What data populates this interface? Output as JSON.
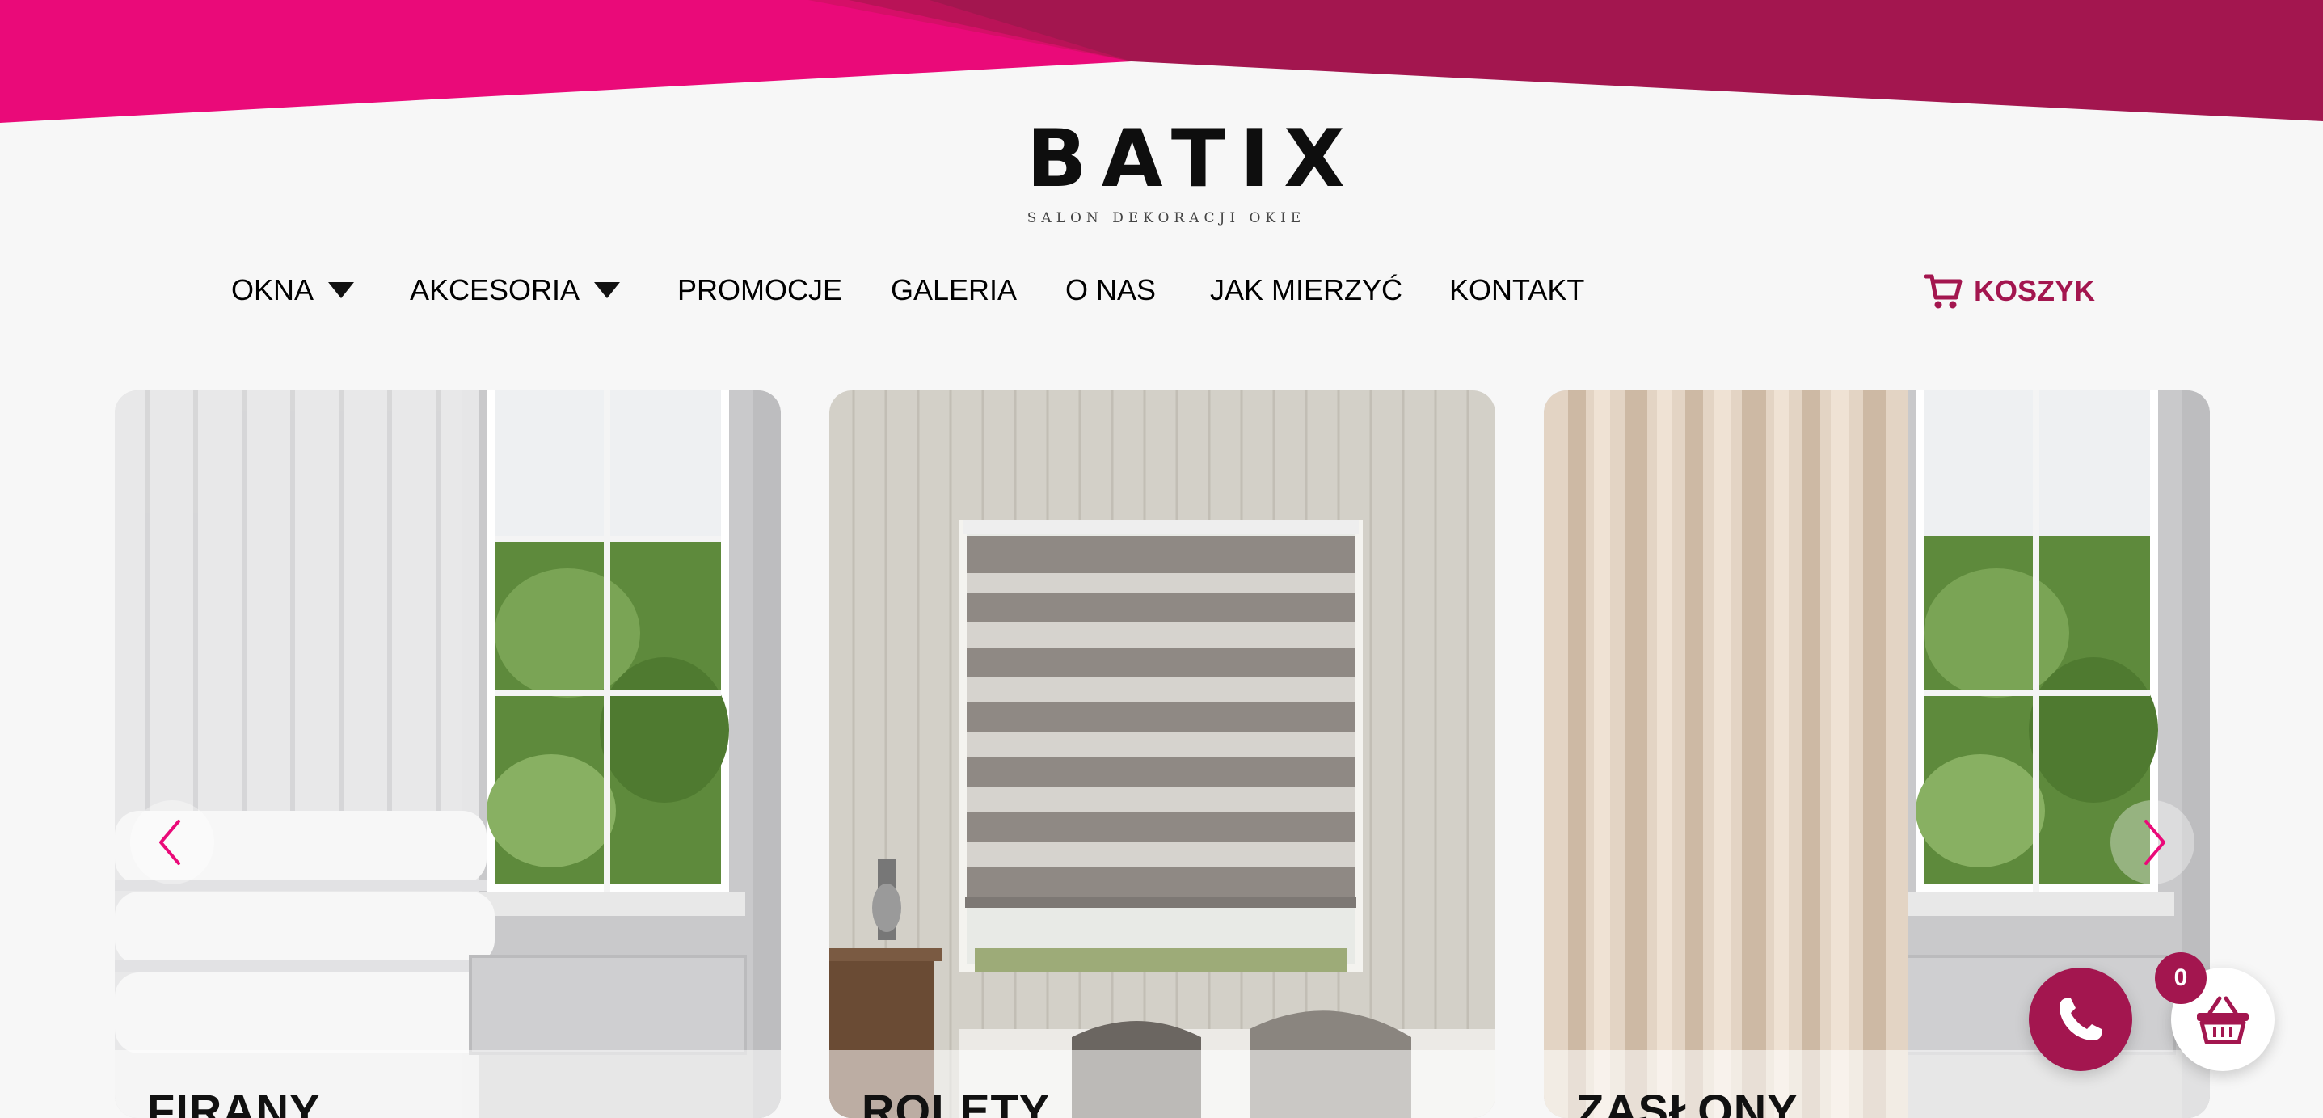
{
  "colors": {
    "brand": "#a3164f",
    "accent_pink": "#ea0a79",
    "background": "#f7f7f7"
  },
  "logo": {
    "wordmark": "BATIX",
    "tagline": "SALON DEKORACJI OKIE"
  },
  "nav": {
    "items": [
      {
        "label": "OKNA",
        "has_dropdown": true
      },
      {
        "label": "AKCESORIA",
        "has_dropdown": true
      },
      {
        "label": "PROMOCJE"
      },
      {
        "label": "GALERIA"
      },
      {
        "label": "O NAS"
      },
      {
        "label": "JAK MIERZYĆ"
      },
      {
        "label": "KONTAKT"
      }
    ],
    "cart_label": "KOSZYK",
    "cart_icon": "cart-icon"
  },
  "carousel": {
    "cards": [
      {
        "title": "FIRANY",
        "image": "sheer-curtain-window-photo"
      },
      {
        "title": "ROLETY",
        "image": "roller-blind-window-photo"
      },
      {
        "title": "ZASŁONY",
        "image": "drape-curtain-window-photo"
      }
    ],
    "prev_icon": "chevron-left-icon",
    "next_icon": "chevron-right-icon"
  },
  "floating": {
    "phone_icon": "phone-icon",
    "basket_icon": "basket-icon",
    "basket_count": "0"
  }
}
